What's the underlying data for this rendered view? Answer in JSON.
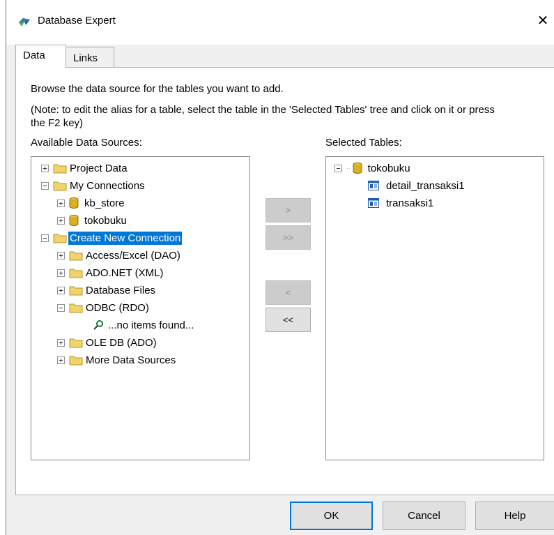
{
  "window": {
    "title": "Database Expert",
    "close_glyph": "✕"
  },
  "tabs": [
    {
      "label": "Data",
      "selected": true
    },
    {
      "label": "Links",
      "selected": false
    }
  ],
  "instructions": {
    "line1": "Browse the data source for the tables you want to add.",
    "line2": "(Note: to edit the alias for a table, select the table in the 'Selected Tables' tree and click on it or press",
    "line3": "the F2 key)"
  },
  "available": {
    "heading": "Available Data Sources:",
    "items": [
      {
        "label": "Project Data",
        "icon": "folder-icon",
        "expander": "plus"
      },
      {
        "label": "My Connections",
        "icon": "folder-icon",
        "expander": "minus"
      },
      {
        "label": "kb_store",
        "icon": "database-icon",
        "expander": "plus"
      },
      {
        "label": "tokobuku",
        "icon": "database-icon",
        "expander": "plus"
      },
      {
        "label": "Create New Connection",
        "icon": "folder-icon",
        "expander": "minus",
        "selected": true
      },
      {
        "label": "Access/Excel (DAO)",
        "icon": "folder-icon",
        "expander": "plus"
      },
      {
        "label": "ADO.NET (XML)",
        "icon": "folder-icon",
        "expander": "plus"
      },
      {
        "label": "Database Files",
        "icon": "folder-icon",
        "expander": "plus"
      },
      {
        "label": "ODBC (RDO)",
        "icon": "folder-icon",
        "expander": "minus"
      },
      {
        "label": "...no items found...",
        "icon": "search-icon",
        "expander": "none"
      },
      {
        "label": "OLE DB (ADO)",
        "icon": "folder-icon",
        "expander": "plus"
      },
      {
        "label": "More Data Sources",
        "icon": "folder-icon",
        "expander": "plus"
      }
    ]
  },
  "selected_tables": {
    "heading": "Selected Tables:",
    "items": [
      {
        "label": "tokobuku",
        "icon": "database-icon",
        "expander": "minus"
      },
      {
        "label": "detail_transaksi1",
        "icon": "table-icon",
        "expander": "none"
      },
      {
        "label": "transaksi1",
        "icon": "table-icon",
        "expander": "none"
      }
    ]
  },
  "transfer_buttons": {
    "add": ">",
    "add_all": ">>",
    "remove": "<",
    "remove_all": "<<"
  },
  "footer": {
    "ok": "OK",
    "cancel": "Cancel",
    "help": "Help"
  },
  "colors": {
    "selection": "#0078d7",
    "folder": "#f2d36b",
    "database": "#d8b020",
    "table": "#1a5fb4"
  }
}
